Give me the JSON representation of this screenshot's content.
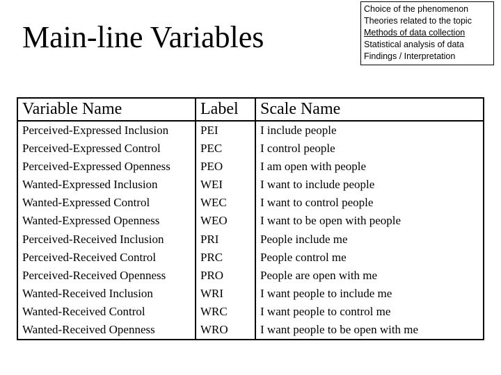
{
  "title": "Main-line Variables",
  "sidebox": {
    "l1": "Choice of the phenomenon",
    "l2": "Theories related to the topic",
    "l3": "Methods of data collection",
    "l4": "Statistical analysis of data",
    "l5": "Findings / Interpretation"
  },
  "table": {
    "headers": {
      "h1": "Variable Name",
      "h2": "Label",
      "h3": "Scale Name"
    },
    "rows": [
      {
        "name": "Perceived-Expressed Inclusion",
        "label": "PEI",
        "scale": "I include people"
      },
      {
        "name": "Perceived-Expressed Control",
        "label": "PEC",
        "scale": "I control people"
      },
      {
        "name": "Perceived-Expressed Openness",
        "label": "PEO",
        "scale": "I am open with people"
      },
      {
        "name": "Wanted-Expressed Inclusion",
        "label": "WEI",
        "scale": "I want to include people"
      },
      {
        "name": "Wanted-Expressed Control",
        "label": "WEC",
        "scale": "I want to control people"
      },
      {
        "name": "Wanted-Expressed Openness",
        "label": "WEO",
        "scale": "I want to be open with people"
      },
      {
        "name": "Perceived-Received Inclusion",
        "label": "PRI",
        "scale": "People include me"
      },
      {
        "name": "Perceived-Received Control",
        "label": "PRC",
        "scale": "People control me"
      },
      {
        "name": "Perceived-Received Openness",
        "label": "PRO",
        "scale": "People are open with me"
      },
      {
        "name": "Wanted-Received Inclusion",
        "label": "WRI",
        "scale": "I want people to include me"
      },
      {
        "name": "Wanted-Received Control",
        "label": "WRC",
        "scale": "I want people to control me"
      },
      {
        "name": "Wanted-Received Openness",
        "label": "WRO",
        "scale": "I want people to be open with me"
      }
    ]
  }
}
